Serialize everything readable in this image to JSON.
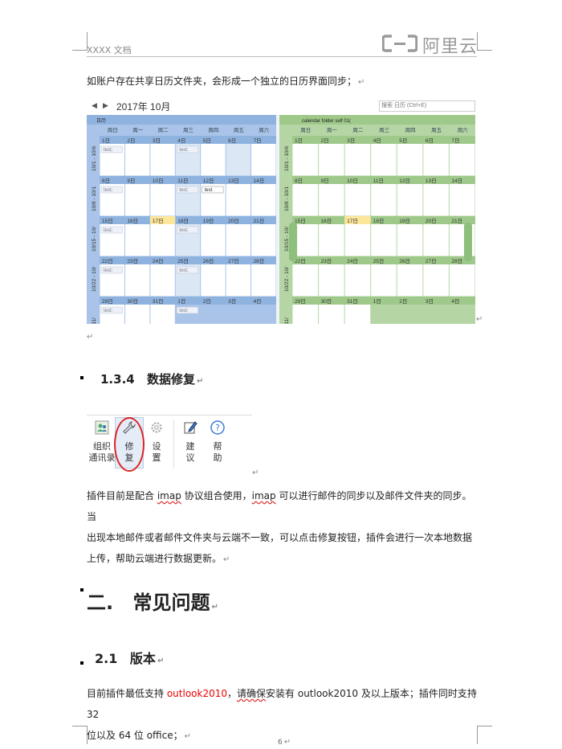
{
  "header": {
    "doc_label": "XXXX 文档",
    "logo_text": "阿里云"
  },
  "intro_text": "如账户存在共享日历文件夹，会形成一个独立的日历界面同步；",
  "calendar": {
    "month_title": "2017年 10月",
    "search_placeholder": "搜索 日历 (Ctrl+E)",
    "left_tab": "日历",
    "right_tab": "calendar folder self 01(",
    "weekdays": [
      "周日",
      "周一",
      "周二",
      "周三",
      "周四",
      "周五",
      "周六"
    ],
    "weeks": [
      {
        "label": "10/1 - 10/6",
        "days": [
          "1日",
          "2日",
          "3日",
          "4日",
          "5日",
          "6日",
          "7日"
        ]
      },
      {
        "label": "10/8 - 10/1",
        "days": [
          "8日",
          "9日",
          "10日",
          "11日",
          "12日",
          "13日",
          "14日"
        ]
      },
      {
        "label": "10/15 - 10/",
        "days": [
          "15日",
          "16日",
          "17日",
          "18日",
          "19日",
          "20日",
          "21日"
        ]
      },
      {
        "label": "10/22 - 10/",
        "days": [
          "22日",
          "23日",
          "24日",
          "25日",
          "26日",
          "27日",
          "28日"
        ]
      },
      {
        "label": "9 - 11/",
        "days": [
          "29日",
          "30日",
          "31日",
          "1日",
          "2日",
          "3日",
          "4日"
        ]
      }
    ],
    "event_label": "test;",
    "event_label_2": "test"
  },
  "section_134": {
    "number": "1.3.4",
    "title": "数据修复"
  },
  "toolbar": {
    "buttons": [
      {
        "line1": "组织",
        "line2": "通讯录",
        "icon": "contacts-icon"
      },
      {
        "line1": "修",
        "line2": "复",
        "icon": "wrench-icon"
      },
      {
        "line1": "设",
        "line2": "置",
        "icon": "gear-icon"
      },
      {
        "line1": "建",
        "line2": "议",
        "icon": "edit-icon"
      },
      {
        "line1": "帮",
        "line2": "助",
        "icon": "help-icon"
      }
    ]
  },
  "para_repair": {
    "line1_a": "插件目前是配合 ",
    "line1_imap1": "imap",
    "line1_b": " 协议组合使用，",
    "line1_imap2": "imap",
    "line1_c": " 可以进行邮件的同步以及邮件文件夹的同步。当",
    "line2": "出现本地邮件或者邮件文件夹与云端不一致，可以点击修复按钮，插件会进行一次本地数据",
    "line3": "上传，帮助云端进行数据更新。"
  },
  "section_2": {
    "number": "二.",
    "title": "常见问题"
  },
  "section_21": {
    "number": "2.1",
    "title": "版本"
  },
  "para_version": {
    "line1_a": "目前插件最低支持 ",
    "line1_red": "outlook2010",
    "line1_b": "，",
    "line1_wavy": "请确保",
    "line1_c": "安装有 outlook2010 及以上版本；插件同时支持 32",
    "line2": "位以及 64 位 office；"
  },
  "footer": {
    "page_number": "6"
  },
  "colors": {
    "left_pane": "#a9c4e8",
    "right_pane": "#b5d6a4",
    "red_text": "#e00000",
    "today": "#fde59a"
  }
}
